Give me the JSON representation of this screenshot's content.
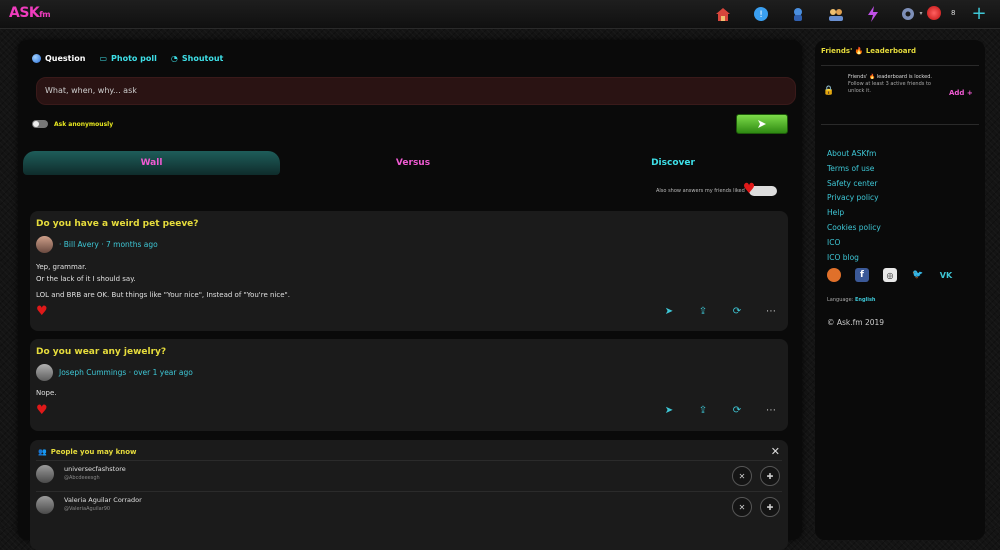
{
  "brand": {
    "logo": "ASK",
    "logo_suffix": "fm"
  },
  "topnav": {
    "icons": [
      "home-icon",
      "answers-icon",
      "discover-icon",
      "friends-icon",
      "lightning-icon",
      "settings-icon",
      "avatar",
      "plus-icon"
    ],
    "notification_count": "8"
  },
  "compose": {
    "tabs": {
      "question": "Question",
      "photo_poll": "Photo poll",
      "shoutout": "Shoutout"
    },
    "placeholder": "What, when, why... ask",
    "anonymous_label": "Ask anonymously"
  },
  "feed": {
    "tabs": {
      "wall": "Wall",
      "versus": "Versus",
      "discover": "Discover"
    },
    "answers_toggle_label": "Also show answers my friends liked"
  },
  "posts": [
    {
      "question": "Do you have a weird pet peeve?",
      "author": "Bill Avery",
      "time": "7 months ago",
      "lines": [
        "Yep, grammar.",
        "Or the lack of it I should say.",
        "LOL and BRB are OK. But things like \"Your nice\", Instead of \"You're nice\"."
      ]
    },
    {
      "question": "Do you wear any jewelry?",
      "author": "Joseph Cummings",
      "time": "over 1 year ago",
      "lines": [
        "Nope."
      ]
    }
  ],
  "pymk": {
    "title": "People you may know",
    "people": [
      {
        "name": "universecfashstore",
        "username": "@Abcdeeesgh"
      },
      {
        "name": "Valeria Aguilar Corrador",
        "username": "@ValeriaAguilar90"
      }
    ]
  },
  "sidebar": {
    "title": "Friends' 🔥 Leaderboard",
    "leaderboard_heading": "Friends' 🔥 leaderboard is locked.",
    "leaderboard_sub": "Follow at least 3 active friends to unlock it.",
    "add_label": "Add +",
    "links": [
      "About ASKfm",
      "Terms of use",
      "Safety center",
      "Privacy policy",
      "Help",
      "Cookies policy",
      "ICO",
      "ICO blog"
    ],
    "language_label": "Language:",
    "language_value": "English",
    "copyright": "© Ask.fm 2019"
  },
  "colors": {
    "accent_pink": "#f05ad2",
    "accent_cyan": "#3ec7d6",
    "title_yellow": "#e6dc3c",
    "like_red": "#e01919"
  }
}
